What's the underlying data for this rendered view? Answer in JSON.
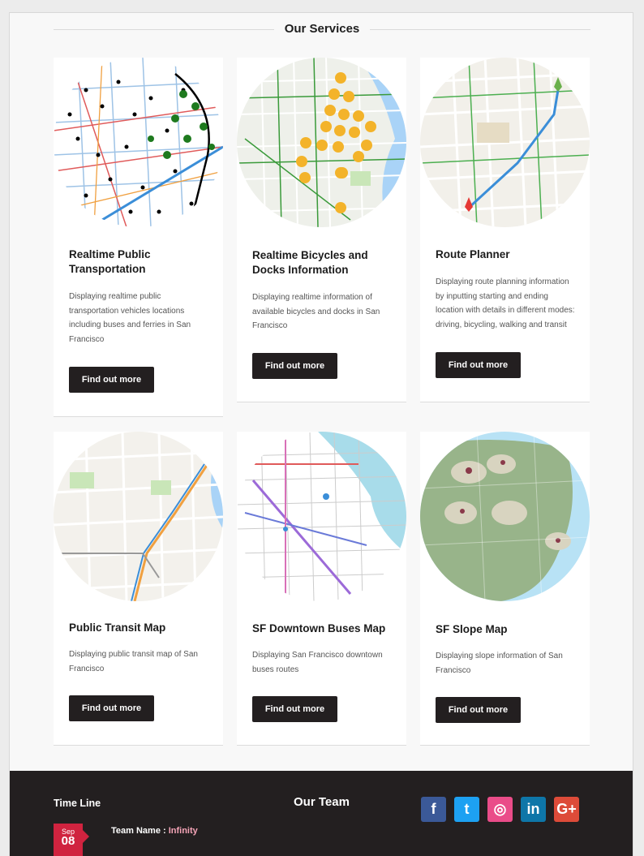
{
  "services_title": "Our Services",
  "cards": [
    {
      "title": "Realtime Public Transportation",
      "desc": "Displaying realtime public transportation vehicles locations including buses and ferries in San Francisco",
      "button": "Find out more"
    },
    {
      "title": "Realtime Bicycles and Docks Information",
      "desc": "Displaying realtime information of available bicycles and docks in San Francisco",
      "button": "Find out more"
    },
    {
      "title": "Route Planner",
      "desc": "Displaying route planning information by inputting starting and ending location with details in different modes: driving, bicycling, walking and transit",
      "button": "Find out more"
    },
    {
      "title": "Public Transit Map",
      "desc": "Displaying public transit map of San Francisco",
      "button": "Find out more"
    },
    {
      "title": "SF Downtown Buses Map",
      "desc": "Displaying San Francisco downtown buses routes",
      "button": "Find out more"
    },
    {
      "title": "SF Slope Map",
      "desc": "Displaying slope information of San Francisco",
      "button": "Find out more"
    }
  ],
  "footer": {
    "timeline_title": "Time Line",
    "team_title": "Our Team",
    "date_month": "Sep",
    "date_day": "08",
    "team_label": "Team Name : ",
    "team_name": "Infinity",
    "socials": [
      {
        "icon": "facebook-icon",
        "glyph": "f",
        "color": "#3b5998"
      },
      {
        "icon": "twitter-icon",
        "glyph": "t",
        "color": "#1da1f2"
      },
      {
        "icon": "dribbble-icon",
        "glyph": "◎",
        "color": "#ea4c89"
      },
      {
        "icon": "linkedin-icon",
        "glyph": "in",
        "color": "#0e76a8"
      },
      {
        "icon": "google-plus-icon",
        "glyph": "G+",
        "color": "#dd4b39"
      }
    ]
  }
}
